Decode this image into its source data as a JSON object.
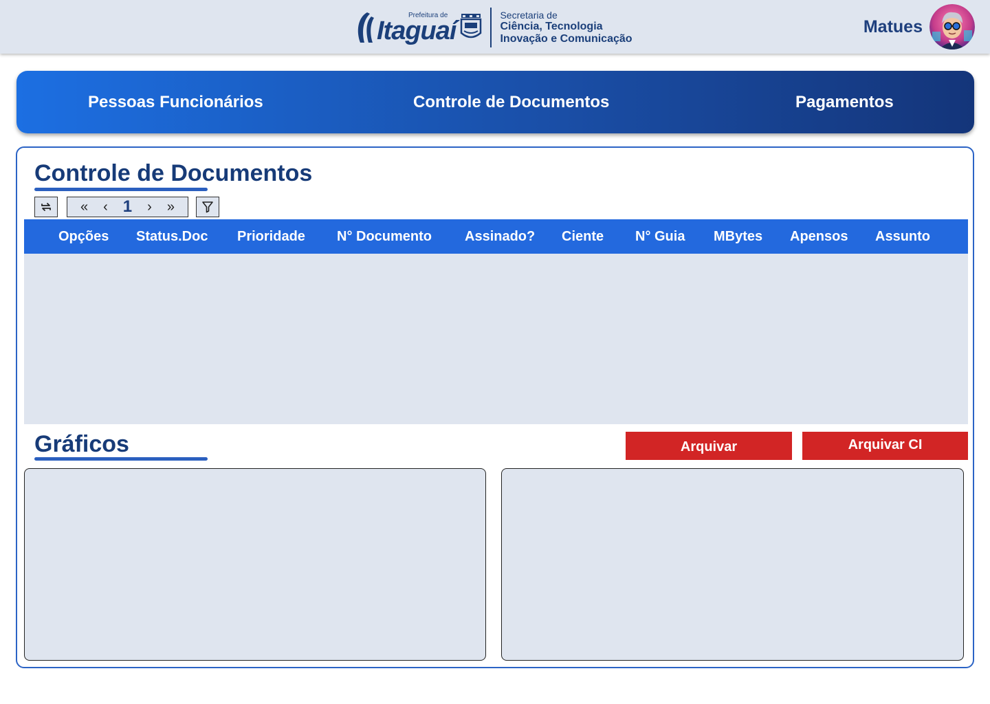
{
  "header": {
    "logo": {
      "prefix": "Prefeitura de",
      "name": "Itaguaí"
    },
    "secretaria": {
      "line1": "Secretaria de",
      "line2": "Ciência, Tecnologia",
      "line3": "Inovação e Comunicação"
    },
    "user": {
      "name": "Matues"
    }
  },
  "nav": {
    "items": [
      {
        "label": "Pessoas Funcionários"
      },
      {
        "label": "Controle de Documentos"
      },
      {
        "label": "Pagamentos"
      }
    ]
  },
  "documents": {
    "title": "Controle de Documentos",
    "pager": {
      "first": "«",
      "prev": "‹",
      "page": "1",
      "next": "›",
      "last": "»"
    },
    "columns": [
      "Opções",
      "Status.Doc",
      "Prioridade",
      "N° Documento",
      "Assinado?",
      "Ciente",
      "N° Guia",
      "MBytes",
      "Apensos",
      "Assunto"
    ],
    "rows": []
  },
  "graphs": {
    "title": "Gráficos",
    "archive_label": "Arquivar",
    "archive_ci_label": "Arquivar CI"
  },
  "colors": {
    "primary": "#2369de",
    "title": "#173b78",
    "danger": "#d22525",
    "surface": "#dfe5ef"
  }
}
